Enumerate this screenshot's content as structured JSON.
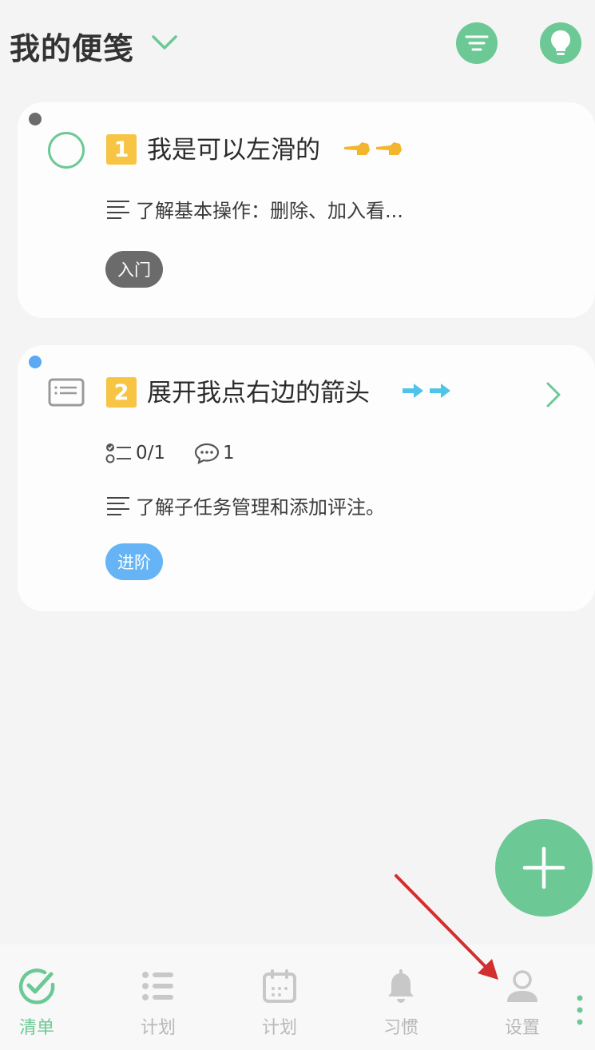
{
  "header": {
    "title": "我的便笺",
    "icons": [
      "chevron-down-icon",
      "filter-icon",
      "lightbulb-icon"
    ]
  },
  "cards": [
    {
      "number": "1",
      "title": "我是可以左滑的",
      "emoji": "👈👈",
      "description": "了解基本操作：删除、加入看...",
      "tag": "入门",
      "dot_color": "#6b6b6b",
      "tag_color": "#6b6b6b"
    },
    {
      "number": "2",
      "title": "展开我点右边的箭头",
      "emoji": "➡➡",
      "subtasks": "0/1",
      "comments": "1",
      "description": "了解子任务管理和添加评注。",
      "tag": "进阶",
      "dot_color": "#5aa9f2",
      "tag_color": "#66b4f5"
    }
  ],
  "bottom_nav": {
    "items": [
      {
        "label": "清单",
        "icon": "checklist-icon",
        "active": true
      },
      {
        "label": "计划",
        "icon": "list-icon",
        "active": false
      },
      {
        "label": "计划",
        "icon": "calendar-icon",
        "active": false
      },
      {
        "label": "习惯",
        "icon": "bell-icon",
        "active": false
      },
      {
        "label": "设置",
        "icon": "user-icon",
        "active": false
      }
    ]
  },
  "colors": {
    "accent": "#6cc996",
    "badge": "#f7c443",
    "annotation_arrow": "#d32f2f"
  }
}
